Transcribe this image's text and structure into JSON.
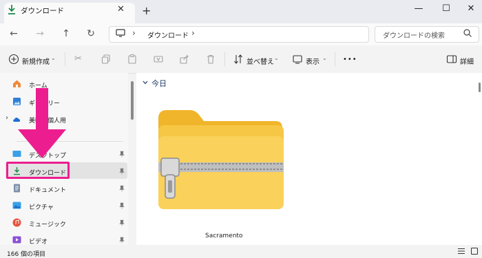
{
  "window": {
    "tab_title": "ダウンロード",
    "new_tab": "+",
    "minimize": "—",
    "maximize": "☐",
    "close": "✕"
  },
  "address": {
    "path": "ダウンロード",
    "search_placeholder": "ダウンロードの検索"
  },
  "toolbar": {
    "new_label": "新規作成",
    "sort_label": "並べ替え",
    "view_label": "表示",
    "more": "•••",
    "details_label": "詳細"
  },
  "sidebar": {
    "items": [
      {
        "label": "ホーム"
      },
      {
        "label": "ギャラリー"
      },
      {
        "label": "美咲 - 個人用"
      },
      {
        "label": "デスクトップ"
      },
      {
        "label": "ダウンロード"
      },
      {
        "label": "ドキュメント"
      },
      {
        "label": "ピクチャ"
      },
      {
        "label": "ミュージック"
      },
      {
        "label": "ビデオ"
      }
    ]
  },
  "main": {
    "group_label": "今日",
    "files": [
      {
        "name": "Sacramento",
        "type": "zip-folder"
      }
    ]
  },
  "status": {
    "item_count": "166 個の項目"
  },
  "colors": {
    "highlight": "#ec1d8f",
    "accent": "#2f7a3d",
    "folder": "#f6c744"
  }
}
